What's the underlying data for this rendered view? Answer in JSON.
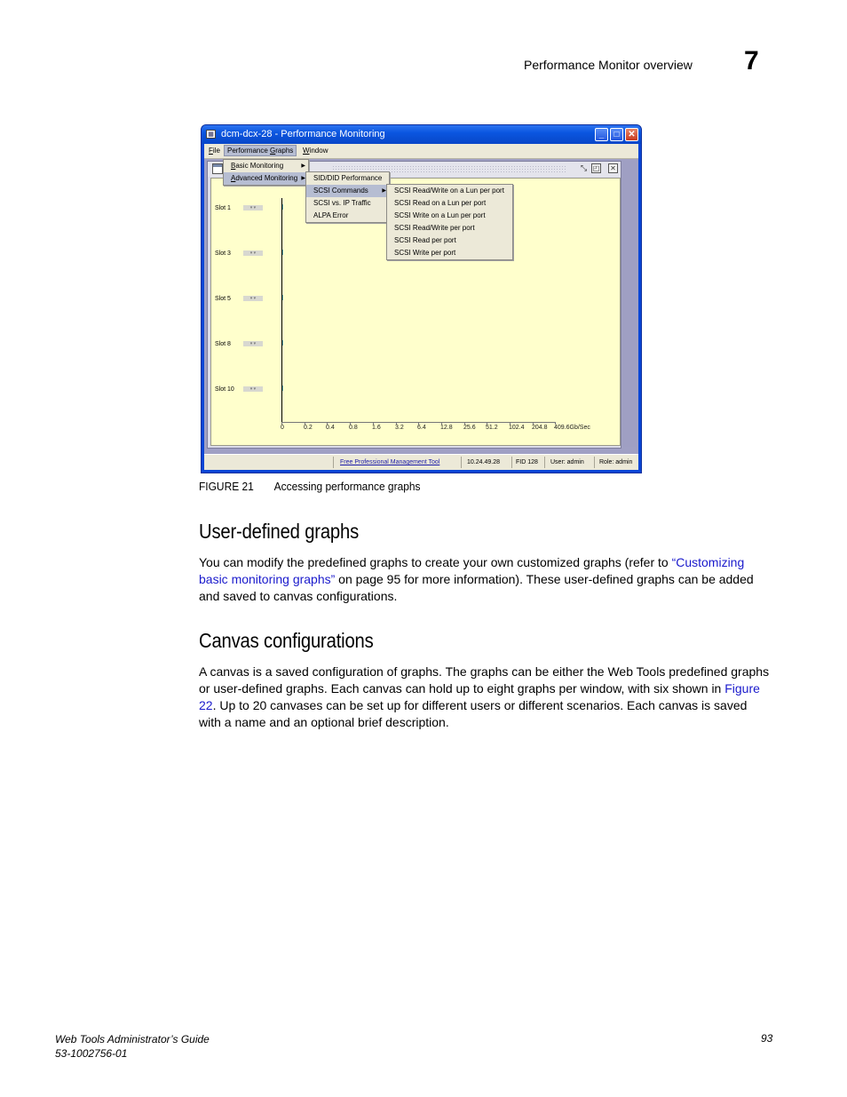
{
  "page_header": {
    "section_title": "Performance Monitor overview",
    "chapter_number": "7"
  },
  "figure": {
    "window": {
      "title": "dcm-dcx-28 - Performance Monitoring",
      "icon": "chart-app-icon",
      "controls": {
        "minimize": "_",
        "maximize": "□",
        "close": "✕"
      },
      "menubar": [
        {
          "label": "File",
          "mnemonic": "F"
        },
        {
          "label": "Performance Graphs",
          "mnemonic": "G",
          "active": true
        },
        {
          "label": "Window",
          "mnemonic": "W"
        }
      ],
      "menu_performance_graphs": [
        {
          "label": "Basic Monitoring",
          "has_submenu": true
        },
        {
          "label": "Advanced Monitoring",
          "has_submenu": true,
          "selected": true
        }
      ],
      "submenu_advanced_monitoring": [
        {
          "label": "SID/DID Performance"
        },
        {
          "label": "SCSI Commands",
          "has_submenu": true,
          "selected": true
        },
        {
          "label": "SCSI vs. IP Traffic"
        },
        {
          "label": "ALPA Error"
        }
      ],
      "submenu_scsi_commands": [
        {
          "label": "SCSI Read/Write on a Lun per port"
        },
        {
          "label": "SCSI Read on a Lun per port"
        },
        {
          "label": "SCSI Write on a Lun per port"
        },
        {
          "label": "SCSI Read/Write per port"
        },
        {
          "label": "SCSI Read per port"
        },
        {
          "label": "SCSI Write per port"
        }
      ],
      "graph": {
        "slots": [
          "Slot 1",
          "Slot 3",
          "Slot 5",
          "Slot 8",
          "Slot 10"
        ],
        "x_ticks": [
          "0",
          "0.2",
          "0.4",
          "0.8",
          "1.6",
          "3.2",
          "6.4",
          "12.8",
          "25.6",
          "51.2",
          "102.4",
          "204.8",
          "409.6Gb/Sec"
        ]
      },
      "frame_icons": [
        "restore-icon",
        "detach-icon",
        "close-frame-icon"
      ],
      "statusbar": {
        "link": "Free Professional Management Tool",
        "ip": "10.24.49.28",
        "fid": "FID 128",
        "user": "User: admin",
        "role": "Role: admin"
      }
    },
    "caption_number": "FIGURE 21",
    "caption_text": "Accessing performance graphs"
  },
  "sections": [
    {
      "heading": "User-defined graphs",
      "para_before_link": "You can modify the predefined graphs to create your own customized graphs (refer to ",
      "link_text": "“Customizing basic monitoring graphs”",
      "para_after_link": " on page 95 for more information). These user-defined graphs can be added and saved to canvas configurations."
    },
    {
      "heading": "Canvas configurations",
      "para_before_link": "A canvas is a saved configuration of graphs. The graphs can be either the Web Tools predefined graphs or user-defined graphs. Each canvas can hold up to eight graphs per window, with six shown in ",
      "link_text": "Figure 22",
      "para_after_link": ". Up to 20 canvases can be set up for different users or different scenarios. Each canvas is saved with a name and an optional brief description."
    }
  ],
  "footer": {
    "guide_title": "Web Tools Administrator’s Guide",
    "doc_number": "53-1002756-01",
    "page_number": "93"
  }
}
